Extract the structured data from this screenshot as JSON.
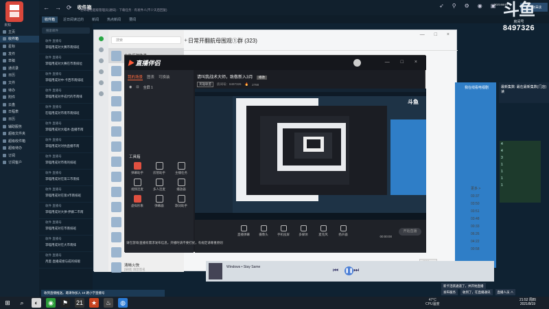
{
  "mail": {
    "logo_text": "",
    "user_label": "未知",
    "nav": [
      "主页",
      "收件箱",
      "星标",
      "发件",
      "草稿",
      "通讯录",
      "日历",
      "文件",
      "待办",
      "附件",
      "云盘",
      "日程表",
      "日历",
      "辅助服务",
      "超级文件夹",
      "超级收件箱",
      "超级待办",
      "订阅",
      "订阅客户"
    ],
    "title": "收件箱",
    "subtitle": "在邮箱过超级管理员(通知) · 下载任务 · 有发件人(不少天后回复)",
    "tabs": [
      "收件箱",
      "近日阅读过的",
      "新闻",
      "热点新闻",
      "要闻"
    ],
    "search_placeholder": "搜索邮件",
    "rows": [
      {
        "from": "收件 直播号",
        "subj": "李喵用成对大赛市南排班"
      },
      {
        "from": "收件 直播号",
        "subj": "李喵用成对大赛在市南排位"
      },
      {
        "from": "收件 直播号",
        "subj": "李喵用成对中-卡西市南排班"
      },
      {
        "from": "收件 直播号",
        "subj": "李喵用成对手成代的市南排"
      },
      {
        "from": "收件 直播号",
        "subj": "在喵用成对市南市南排班"
      },
      {
        "from": "收件 直播号",
        "subj": "李喵用成对大喵木-直播市南"
      },
      {
        "from": "收件 直播号",
        "subj": "李喵用成对对抗直播市南"
      },
      {
        "from": "收件 直播号",
        "subj": "李喵用成对市南的排班"
      },
      {
        "from": "收件 直播号",
        "subj": "李喵用成对在第三市南排"
      },
      {
        "from": "收件 直播号",
        "subj": "李喵用成对在第3市南排班"
      },
      {
        "from": "收件 直播号",
        "subj": "李喵用成对大弹-伊藤二市南"
      },
      {
        "from": "收件 直播号",
        "subj": "李喵用成对在市南排班"
      },
      {
        "from": "收件 直播号",
        "subj": "李喵用成对在大市南排"
      },
      {
        "from": "收件 直播号",
        "subj": "月度-直播成绩与成的排版"
      }
    ]
  },
  "tray": {
    "new_msg": "下一封未读",
    "date": "2021/08/19"
  },
  "overlay": {
    "logo": "斗鱼",
    "logo_sub": "房间号",
    "room_no": "8497326"
  },
  "chat": {
    "search_placeholder": "搜索",
    "add": "+",
    "header_title": "日常开翻航母围观①群 (323)",
    "winctrl": "— □ ×",
    "items": [
      {
        "name": "文件传输助手",
        "snippet": ""
      },
      {
        "name": "Typora",
        "snippet": ""
      },
      {
        "name": "",
        "snippet": ""
      },
      {
        "name": "",
        "snippet": ""
      },
      {
        "name": "",
        "snippet": ""
      },
      {
        "name": "",
        "snippet": ""
      },
      {
        "name": "",
        "snippet": ""
      },
      {
        "name": "",
        "snippet": ""
      },
      {
        "name": "",
        "snippet": ""
      },
      {
        "name": "",
        "snippet": ""
      },
      {
        "name": "",
        "snippet": ""
      },
      {
        "name": "",
        "snippet": ""
      },
      {
        "name": "",
        "snippet": ""
      },
      {
        "name": "",
        "snippet": ""
      },
      {
        "name": "清晰火快",
        "snippet": "[链接] 请您签名"
      }
    ],
    "send_label": "发送(S)"
  },
  "side": {
    "panel_text": "我在线看电视剧",
    "panel2_text": "最新集数: 最在最新集数(门店)读",
    "table": [
      "4",
      "4",
      "3",
      "1",
      "1",
      "1",
      "1"
    ],
    "times": [
      "更多 >",
      "03:37",
      "03:50",
      "03:51",
      "03:48",
      "00:33",
      "06:26",
      "04:22",
      "00:58"
    ]
  },
  "player": {
    "song": "Windows • Stay Same",
    "controls": "⏮ ▶ ⏭"
  },
  "stream": {
    "logo": "直播伴侣",
    "winctrl": "— □ ×",
    "tabs": [
      "我的场景",
      "图表",
      "可换装"
    ],
    "scene_label": "全屏 1",
    "tools_header": "工具箱",
    "tools": [
      {
        "label": "弹幕助手",
        "red": true
      },
      {
        "label": "房管助手",
        "red": false
      },
      {
        "label": "主播任务",
        "red": false
      },
      {
        "label": "视频连麦",
        "red": false
      },
      {
        "label": "多人连麦",
        "red": false
      },
      {
        "label": "播放器",
        "red": false
      },
      {
        "label": "虚拟形象",
        "red": true
      },
      {
        "label": "弹幕器",
        "red": false
      },
      {
        "label": "歌词助手",
        "red": false
      }
    ],
    "room_title": "请叫我战术大师，致敬新入3月",
    "room_tag": "修改",
    "category": "英雄联盟",
    "room_label": "房间号：8497326",
    "followers": "2788",
    "notice": "请在游戏/直播有需求发布信息，开播时请不要打扰，有规定请尊重原则",
    "bottom_btns": [
      "直播弹幕",
      "摄像头",
      "手机投屏",
      "多媒体",
      "麦克风",
      "扬声器"
    ],
    "timer": "00:00:00",
    "golive": "开始直播"
  },
  "taskbar": {
    "icons": [
      "⊞",
      "⌕",
      "◐",
      "◉",
      "⚑",
      "21",
      "★",
      "♨",
      "◍"
    ],
    "task_left": "收到直播推送。邀请你加入 10 路小学直播号",
    "right_rows": [
      [
        "新卡活跃通道了，并开始直播"
      ],
      [
        "发布服务",
        "收到了，在直播通讯",
        "直播人员 ∧"
      ]
    ],
    "tray_temp": "47°C",
    "tray_label": "CPU温度",
    "clock_time": "21:52 周四",
    "clock_date": "2021/8/19"
  }
}
